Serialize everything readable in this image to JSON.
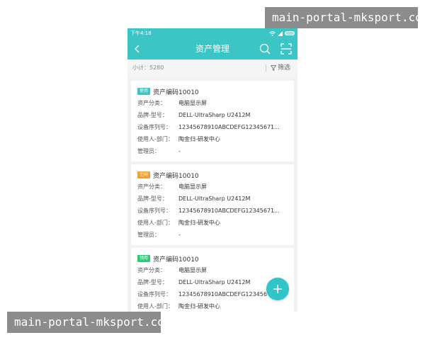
{
  "status_bar": {
    "time": "下午4:18"
  },
  "nav": {
    "title": "资产管理"
  },
  "summary": {
    "count_label": "小计：5280",
    "filter_label": "筛选"
  },
  "cards": [
    {
      "badge": "使用",
      "badge_color": "#3bc5c5",
      "code": "资产编码10010",
      "rows": [
        {
          "label": "资产分类：",
          "value": "电脑显示屏"
        },
        {
          "label": "品牌-型号：",
          "value": "DELL-UltraSharp U2412M"
        },
        {
          "label": "设备序列号：",
          "value": "12345678910ABCDEFG12345671..."
        },
        {
          "label": "使用人-部门：",
          "value": "陶金归-研发中心"
        },
        {
          "label": "管理员：",
          "value": "-"
        }
      ]
    },
    {
      "badge": "空闲",
      "badge_color": "#f0a030",
      "code": "资产编码10010",
      "rows": [
        {
          "label": "资产分类：",
          "value": "电脑显示屏"
        },
        {
          "label": "品牌-型号：",
          "value": "DELL-UltraSharp U2412M"
        },
        {
          "label": "设备序列号：",
          "value": "12345678910ABCDEFG12345671..."
        },
        {
          "label": "使用人-部门：",
          "value": "陶金归-研发中心"
        },
        {
          "label": "管理员：",
          "value": "-"
        }
      ]
    },
    {
      "badge": "领用",
      "badge_color": "#2ecc71",
      "code": "资产编码10010",
      "rows": [
        {
          "label": "资产分类：",
          "value": "电脑显示屏"
        },
        {
          "label": "品牌-型号：",
          "value": "DELL-UltraSharp U2412M"
        },
        {
          "label": "设备序列号：",
          "value": "12345678910ABCDEFG123456"
        },
        {
          "label": "使用人-部门：",
          "value": "陶金归-研发中心"
        }
      ]
    }
  ],
  "watermarks": {
    "top": "main-portal-mksport.com",
    "bottom": "main-portal-mksport.com"
  },
  "icons": {
    "back": "chevron-left-icon",
    "search": "search-icon",
    "scan": "scan-icon",
    "filter": "filter-icon",
    "add": "plus-icon",
    "wifi": "wifi-icon",
    "signal": "signal-icon",
    "battery": "battery-icon"
  },
  "colors": {
    "primary": "#3bc5c5",
    "fab": "#2ec6c6"
  }
}
